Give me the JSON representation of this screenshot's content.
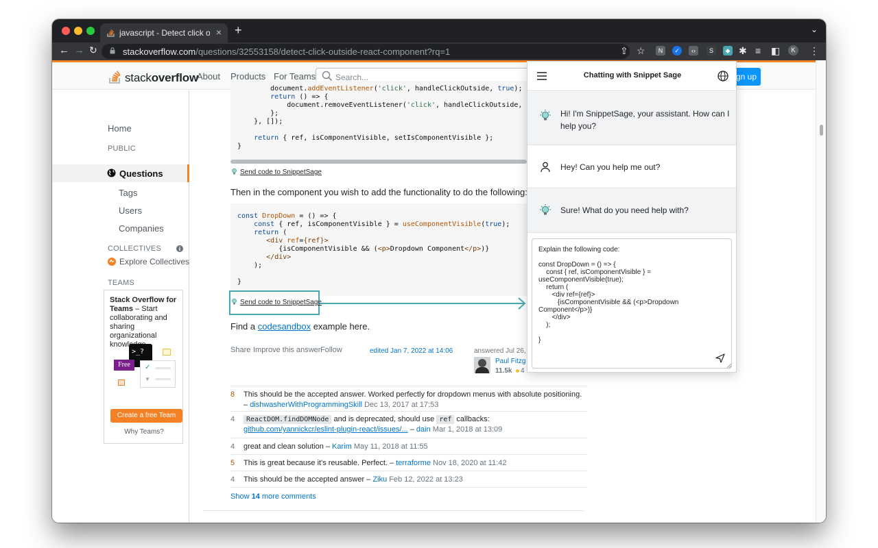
{
  "browser": {
    "tab_title": "javascript - Detect click outside",
    "url_domain": "stackoverflow.com",
    "url_path": "/questions/32553158/detect-click-outside-react-component?rq=1",
    "profile_initial": "K"
  },
  "so_header": {
    "logo_text_plain": "stack",
    "logo_text_bold": "overflow",
    "nav": [
      "About",
      "Products",
      "For Teams"
    ],
    "search_placeholder": "Search...",
    "signup_label": "Sign up",
    "signup_visible": "gn up"
  },
  "sidebar": {
    "home": "Home",
    "public_heading": "PUBLIC",
    "questions": "Questions",
    "tags": "Tags",
    "users": "Users",
    "companies": "Companies",
    "collectives_heading": "COLLECTIVES",
    "explore_collectives": "Explore Collectives",
    "teams_heading": "TEAMS",
    "teams_title": "Stack Overflow for Teams",
    "teams_desc": " – Start collaborating and sharing organizational knowledge.",
    "free_badge": "Free",
    "terminal_text": ">_?",
    "create_team": "Create a free Team",
    "why_teams": "Why Teams?"
  },
  "answer": {
    "code1": [
      "        document.addEventListener('click', handleClickOutside, true);",
      "        return () => {",
      "            document.removeEventListener('click', handleClickOutside, t",
      "        };",
      "    }, []);",
      "",
      "    return { ref, isComponentVisible, setIsComponentVisible };",
      "}"
    ],
    "send_link_1": "Send code to SnippetSage",
    "intro_text": "Then in the component you wish to add the functionality to do the following:",
    "code2": [
      "const DropDown = () => {",
      "    const { ref, isComponentVisible } = useComponentVisible(true);",
      "    return (",
      "       <div ref={ref}>",
      "          {isComponentVisible && (<p>Dropdown Component</p>)}",
      "       </div>",
      "    );",
      "",
      "}"
    ],
    "send_link_2": "Send code to SnippetSage",
    "find_prefix": "Find a ",
    "find_link": "codesandbox",
    "find_suffix": " example here.",
    "actions": [
      "Share",
      "Improve this answer",
      "Follow"
    ],
    "edited": "edited Jan 7, 2022 at 14:06",
    "answered": "answered Jul 26,",
    "author": "Paul Fitzg",
    "rep": "11.5k",
    "badge_gold": "4"
  },
  "comments": [
    {
      "score": "8",
      "highlight": true,
      "text": "This should be the accepted answer. Worked perfectly for dropdown menus with absolute positioning.",
      "user": "dishwasherWithProgrammingSkill",
      "date": "Dec 13, 2017 at 17:53"
    },
    {
      "score": "4",
      "highlight": false,
      "code1": "ReactDOM.findDOMNode",
      "mid": " and is deprecated, should use ",
      "code2": "ref",
      "tail": " callbacks:",
      "link": "github.com/yannickcr/eslint-plugin-react/issues/...",
      "user": "dain",
      "date": "Mar 1, 2018 at 13:09"
    },
    {
      "score": "4",
      "highlight": false,
      "text": "great and clean solution",
      "user": "Karim",
      "date": "May 11, 2018 at 11:55"
    },
    {
      "score": "5",
      "highlight": true,
      "text": "This is great because it's reusable. Perfect.",
      "user": "terraforme",
      "date": "Nov 18, 2020 at 11:42"
    },
    {
      "score": "4",
      "highlight": false,
      "text": "This should be the accepted answer",
      "user": "Ziku",
      "date": "Feb 12, 2022 at 13:23"
    }
  ],
  "show_more": {
    "prefix": "Show ",
    "count": "14",
    "suffix": " more comments"
  },
  "chat": {
    "title": "Chatting with Snippet Sage",
    "messages": [
      {
        "role": "bot",
        "text": "Hi! I'm SnippetSage, your assistant. How can I help you?"
      },
      {
        "role": "user",
        "text": "Hey! Can you help me out?"
      },
      {
        "role": "bot",
        "text": "Sure! What do you need help with?"
      }
    ],
    "input_value": "Explain the following code:\n\nconst DropDown = () => {\n    const { ref, isComponentVisible } =\nuseComponentVisible(true);\n    return (\n       <div ref={ref}>\n          {isComponentVisible && (<p>Dropdown\nComponent</p>)}\n       </div>\n    );\n\n}"
  },
  "colors": {
    "so_orange": "#f48225",
    "link_blue": "#0074cc",
    "highlight_box": "#4aa7b0",
    "chrome_dark": "#202124"
  }
}
